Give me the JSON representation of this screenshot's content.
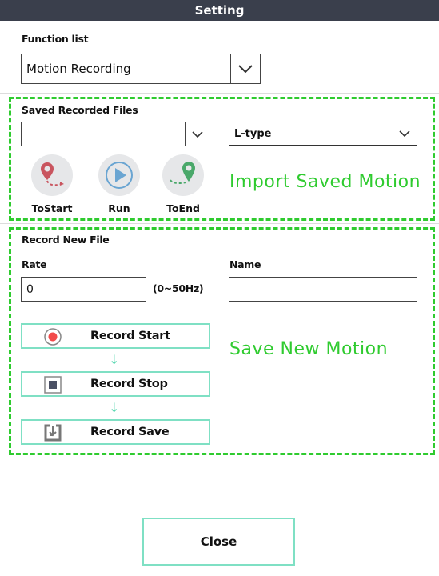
{
  "window": {
    "title": "Setting"
  },
  "function_list": {
    "label": "Function list",
    "selected": "Motion Recording",
    "icon": "chevron-down-icon"
  },
  "saved_files": {
    "label": "Saved Recorded Files",
    "file_selected": "",
    "type_selected": "L-type",
    "buttons": [
      {
        "label": "ToStart",
        "icon": "to-start-icon",
        "color": "#c9555f"
      },
      {
        "label": "Run",
        "icon": "play-icon",
        "color": "#6aa5d2"
      },
      {
        "label": "ToEnd",
        "icon": "to-end-icon",
        "color": "#4aa86a"
      }
    ],
    "annotation": "Import Saved Motion"
  },
  "record_new": {
    "label": "Record New File",
    "rate_label": "Rate",
    "rate_value": "0",
    "rate_hint": "(0~50Hz)",
    "name_label": "Name",
    "name_value": "",
    "buttons": [
      {
        "label": "Record Start",
        "icon": "record-icon",
        "color": "#f24b4b"
      },
      {
        "label": "Record Stop",
        "icon": "stop-icon",
        "color": "#4a5064"
      },
      {
        "label": "Record Save",
        "icon": "save-icon",
        "color": "#777777"
      }
    ],
    "flow_arrow": "↓",
    "annotation": "Save New Motion"
  },
  "footer": {
    "close_label": "Close"
  },
  "colors": {
    "titlebar": "#3a3f4c",
    "annotation": "#2fcb2f",
    "button_border": "#7fe0c4"
  }
}
